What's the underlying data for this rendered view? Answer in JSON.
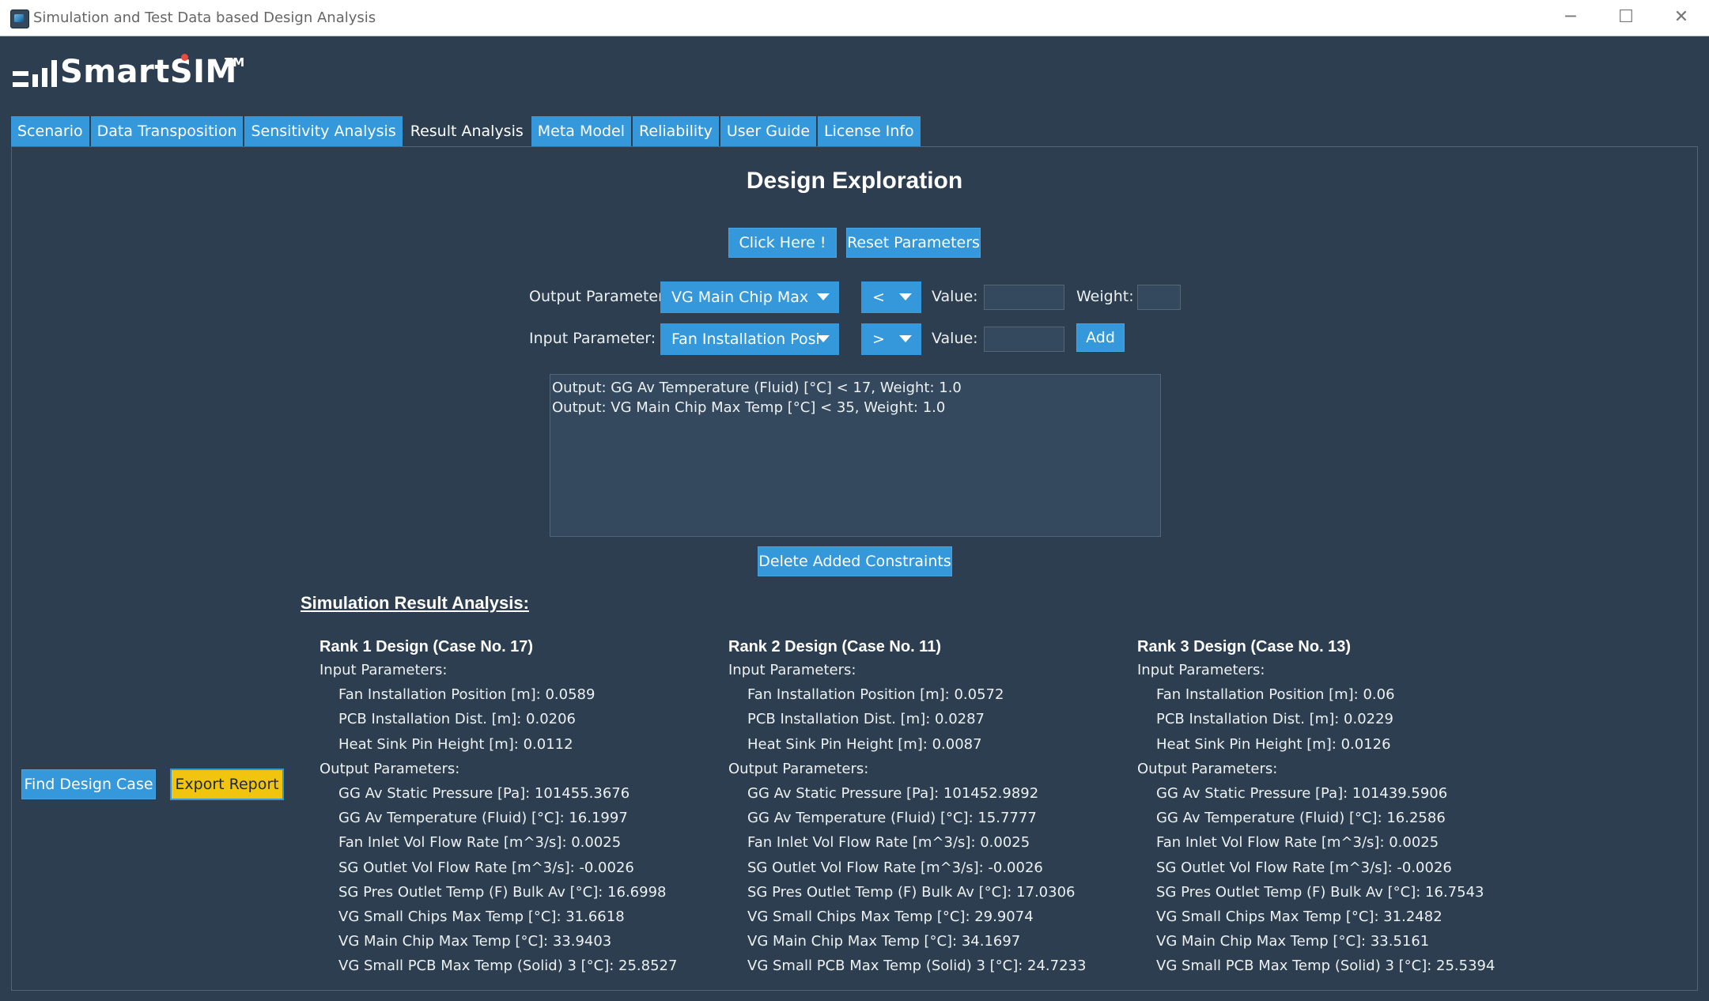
{
  "window": {
    "title": "Simulation and Test Data based Design Analysis",
    "minimize": "─",
    "maximize": "☐",
    "close": "✕"
  },
  "logo": {
    "text": "SmartSIM",
    "tm": "TM"
  },
  "tabs": [
    {
      "label": "Scenario"
    },
    {
      "label": "Data Transposition"
    },
    {
      "label": "Sensitivity Analysis"
    },
    {
      "label": "Result Analysis",
      "active": true
    },
    {
      "label": "Meta Model"
    },
    {
      "label": "Reliability"
    },
    {
      "label": "User Guide"
    },
    {
      "label": "License Info"
    }
  ],
  "design": {
    "title": "Design Exploration",
    "click_label": "Click Here !",
    "reset_label": "Reset Parameters",
    "output_label": "Output Parameter:",
    "output_selected": "VG Main Chip Max",
    "output_op": "<",
    "input_label": "Input Parameter:",
    "input_selected": "Fan Installation Posi",
    "input_op": ">",
    "value_label": "Value:",
    "weight_label": "Weight:",
    "add_label": "Add",
    "constraints": [
      "Output: GG Av Temperature (Fluid) [°C] < 17, Weight: 1.0",
      "Output: VG Main Chip Max Temp [°C] < 35, Weight: 1.0"
    ],
    "delete_label": "Delete Added Constraints"
  },
  "results": {
    "title": "Simulation Result Analysis:",
    "find_label": "Find Design Case",
    "export_label": "Export Report",
    "input_header": "Input Parameters:",
    "output_header": "Output Parameters:",
    "ranks": [
      {
        "title": "Rank 1 Design (Case No. 17)",
        "inputs": [
          "Fan Installation Position [m]: 0.0589",
          "PCB Installation Dist. [m]: 0.0206",
          "Heat Sink Pin Height [m]: 0.0112"
        ],
        "outputs": [
          "GG Av Static Pressure [Pa]: 101455.3676",
          "GG Av Temperature (Fluid) [°C]: 16.1997",
          "Fan Inlet Vol Flow Rate [m^3/s]: 0.0025",
          "SG Outlet Vol Flow Rate [m^3/s]: -0.0026",
          "SG Pres Outlet Temp (F) Bulk Av [°C]: 16.6998",
          "VG Small Chips Max Temp [°C]: 31.6618",
          "VG Main Chip Max Temp [°C]: 33.9403",
          "VG Small PCB Max Temp (Solid) 3 [°C]: 25.8527"
        ]
      },
      {
        "title": "Rank 2 Design (Case No. 11)",
        "inputs": [
          "Fan Installation Position [m]: 0.0572",
          "PCB Installation Dist. [m]: 0.0287",
          "Heat Sink Pin Height [m]: 0.0087"
        ],
        "outputs": [
          "GG Av Static Pressure [Pa]: 101452.9892",
          "GG Av Temperature (Fluid) [°C]: 15.7777",
          "Fan Inlet Vol Flow Rate [m^3/s]: 0.0025",
          "SG Outlet Vol Flow Rate [m^3/s]: -0.0026",
          "SG Pres Outlet Temp (F) Bulk Av [°C]: 17.0306",
          "VG Small Chips Max Temp [°C]: 29.9074",
          "VG Main Chip Max Temp [°C]: 34.1697",
          "VG Small PCB Max Temp (Solid) 3 [°C]: 24.7233"
        ]
      },
      {
        "title": "Rank 3 Design (Case No. 13)",
        "inputs": [
          "Fan Installation Position [m]: 0.06",
          "PCB Installation Dist. [m]: 0.0229",
          "Heat Sink Pin Height [m]: 0.0126"
        ],
        "outputs": [
          "GG Av Static Pressure [Pa]: 101439.5906",
          "GG Av Temperature (Fluid) [°C]: 16.2586",
          "Fan Inlet Vol Flow Rate [m^3/s]: 0.0025",
          "SG Outlet Vol Flow Rate [m^3/s]: -0.0026",
          "SG Pres Outlet Temp (F) Bulk Av [°C]: 16.7543",
          "VG Small Chips Max Temp [°C]: 31.2482",
          "VG Main Chip Max Temp [°C]: 33.5161",
          "VG Small PCB Max Temp (Solid) 3 [°C]: 25.5394"
        ]
      }
    ]
  }
}
